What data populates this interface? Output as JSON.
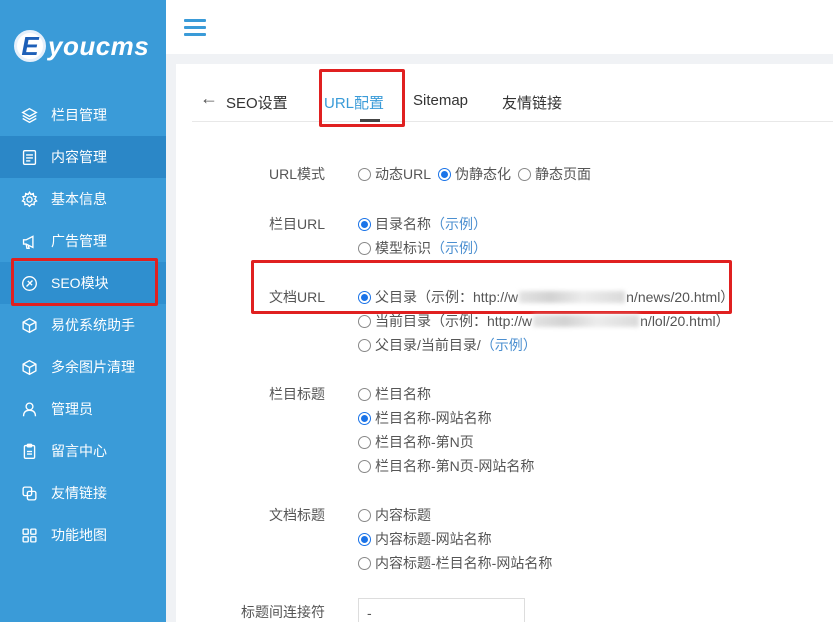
{
  "brand": {
    "logo_letter": "E",
    "logo_text": "youcms"
  },
  "sidebar": {
    "items": [
      {
        "label": "栏目管理",
        "icon": "layers-icon"
      },
      {
        "label": "内容管理",
        "icon": "document-icon"
      },
      {
        "label": "基本信息",
        "icon": "gear-icon"
      },
      {
        "label": "广告管理",
        "icon": "megaphone-icon"
      },
      {
        "label": "SEO模块",
        "icon": "seo-icon"
      },
      {
        "label": "易优系统助手",
        "icon": "cube-icon"
      },
      {
        "label": "多余图片清理",
        "icon": "cube-icon"
      },
      {
        "label": "管理员",
        "icon": "user-icon"
      },
      {
        "label": "留言中心",
        "icon": "clipboard-icon"
      },
      {
        "label": "友情链接",
        "icon": "link-icon"
      },
      {
        "label": "功能地图",
        "icon": "grid-icon"
      }
    ]
  },
  "tabs": [
    {
      "label": "SEO设置"
    },
    {
      "label": "URL配置"
    },
    {
      "label": "Sitemap"
    },
    {
      "label": "友情链接"
    }
  ],
  "form": {
    "url_mode": {
      "label": "URL模式",
      "options": [
        {
          "label": "动态URL",
          "checked": false
        },
        {
          "label": "伪静态化",
          "checked": true
        },
        {
          "label": "静态页面",
          "checked": false
        }
      ]
    },
    "category_url": {
      "label": "栏目URL",
      "options": [
        {
          "label": "目录名称",
          "example": "（示例）",
          "checked": true
        },
        {
          "label": "模型标识",
          "example": "（示例）",
          "checked": false
        }
      ]
    },
    "document_url": {
      "label": "文档URL",
      "options": [
        {
          "label": "父目录",
          "example_prefix": "（示例：http://w",
          "example_suffix": "n/news/20.html）",
          "checked": true
        },
        {
          "label": "当前目录",
          "example_prefix": "（示例：http://w",
          "example_suffix": "n/lol/20.html）",
          "checked": false
        },
        {
          "label": "父目录/当前目录/",
          "example": "（示例）",
          "checked": false
        }
      ]
    },
    "category_title": {
      "label": "栏目标题",
      "options": [
        {
          "label": "栏目名称",
          "checked": false
        },
        {
          "label": "栏目名称-网站名称",
          "checked": true
        },
        {
          "label": "栏目名称-第N页",
          "checked": false
        },
        {
          "label": "栏目名称-第N页-网站名称",
          "checked": false
        }
      ]
    },
    "document_title": {
      "label": "文档标题",
      "options": [
        {
          "label": "内容标题",
          "checked": false
        },
        {
          "label": "内容标题-网站名称",
          "checked": true
        },
        {
          "label": "内容标题-栏目名称-网站名称",
          "checked": false
        }
      ]
    },
    "title_separator": {
      "label": "标题间连接符",
      "value": "-"
    }
  },
  "colors": {
    "sidebar": "#3a9bd8",
    "accent": "#1a73e8",
    "highlight": "#e02020"
  }
}
